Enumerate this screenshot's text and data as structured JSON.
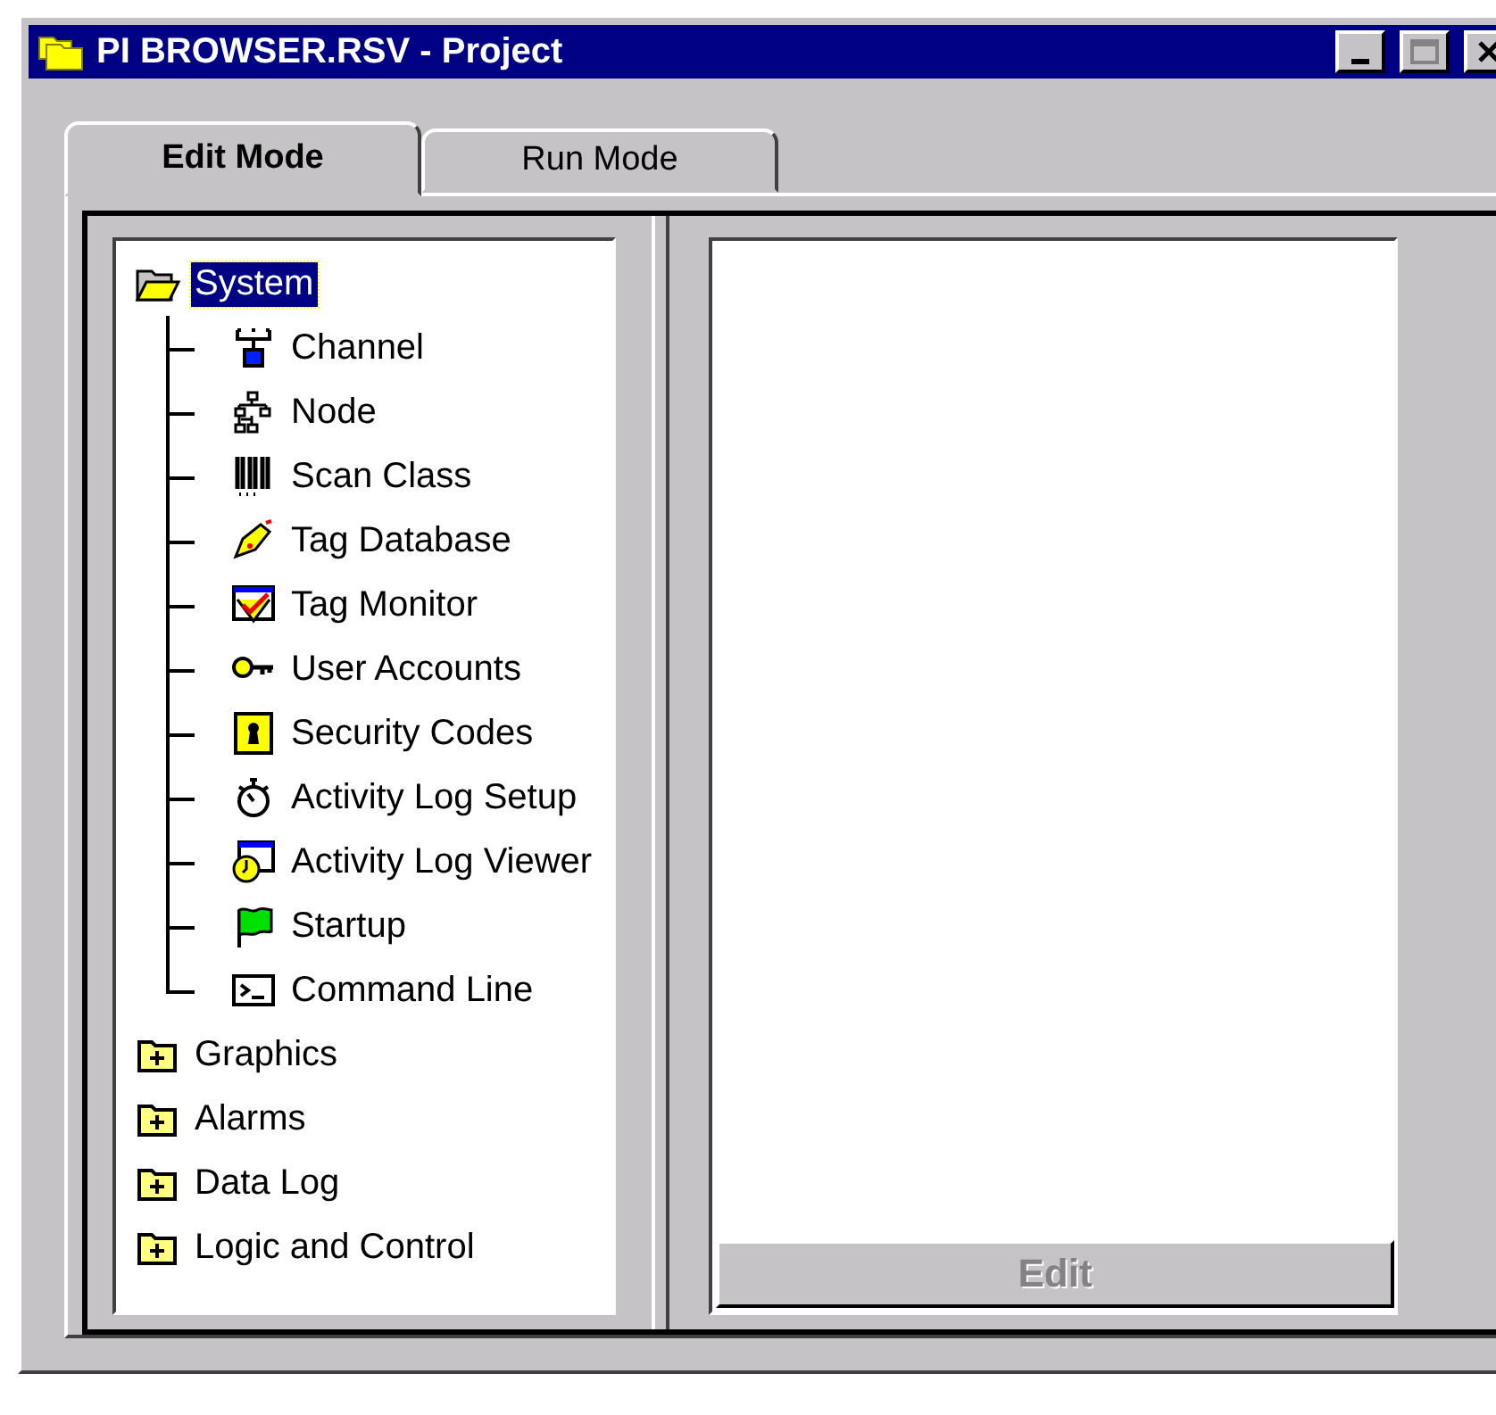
{
  "window": {
    "title": "PI BROWSER.RSV - Project"
  },
  "tabs": [
    {
      "label": "Edit Mode",
      "selected": true
    },
    {
      "label": "Run Mode",
      "selected": false
    }
  ],
  "tree": [
    {
      "label": "System",
      "selected": true,
      "expanded": true,
      "children": [
        {
          "label": "Channel"
        },
        {
          "label": "Node"
        },
        {
          "label": "Scan Class"
        },
        {
          "label": "Tag Database"
        },
        {
          "label": "Tag Monitor"
        },
        {
          "label": "User Accounts"
        },
        {
          "label": "Security Codes"
        },
        {
          "label": "Activity Log Setup"
        },
        {
          "label": "Activity Log Viewer"
        },
        {
          "label": "Startup"
        },
        {
          "label": "Command Line"
        }
      ]
    },
    {
      "label": "Graphics",
      "selected": false,
      "expanded": false
    },
    {
      "label": "Alarms",
      "selected": false,
      "expanded": false
    },
    {
      "label": "Data Log",
      "selected": false,
      "expanded": false
    },
    {
      "label": "Logic and Control",
      "selected": false,
      "expanded": false
    }
  ],
  "edit_button": {
    "label": "Edit",
    "disabled": true
  }
}
